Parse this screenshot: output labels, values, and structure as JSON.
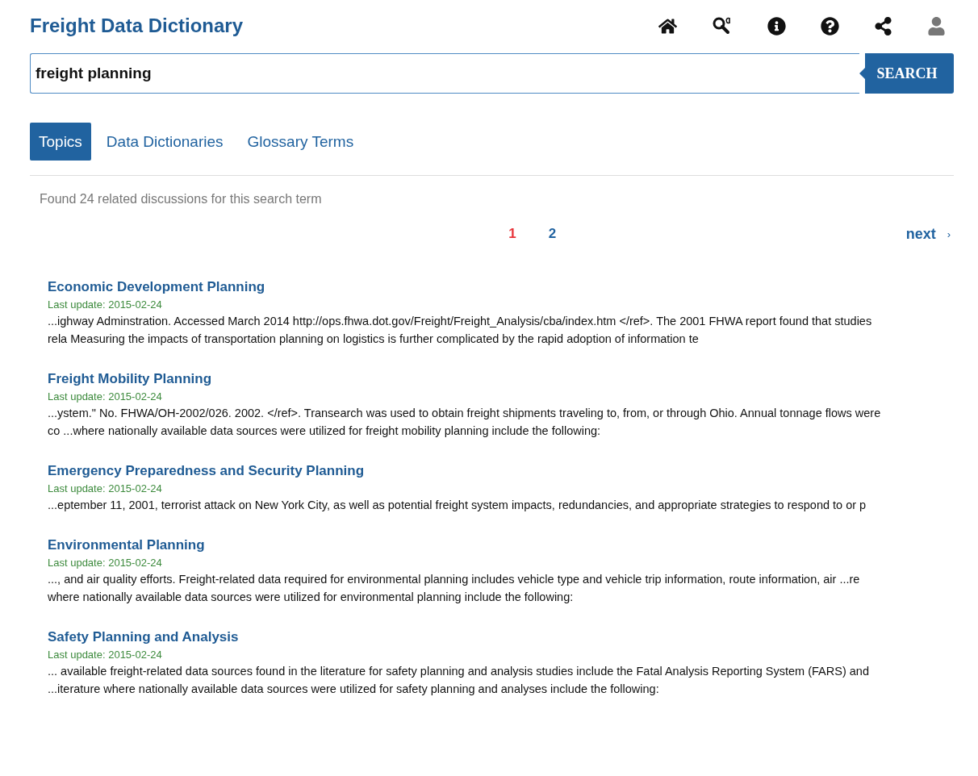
{
  "header": {
    "title": "Freight Data Dictionary",
    "icons": [
      {
        "kind": "home"
      },
      {
        "kind": "glossary"
      },
      {
        "kind": "info"
      },
      {
        "kind": "help"
      },
      {
        "kind": "share"
      },
      {
        "kind": "user"
      }
    ]
  },
  "search": {
    "value": "freight planning",
    "button": "SEARCH"
  },
  "tabs": [
    {
      "label": "Topics",
      "selected": true
    },
    {
      "label": "Data Dictionaries",
      "selected": false
    },
    {
      "label": "Glossary Terms",
      "selected": false
    }
  ],
  "summary": "Found 24 related discussions for this search term",
  "pagination": {
    "pages": [
      {
        "label": "1",
        "selected": true
      },
      {
        "label": "2",
        "selected": false
      }
    ],
    "next": "next",
    "next_arrow": "›"
  },
  "results": [
    {
      "title": "Economic Development Planning",
      "updated": "Last update: 2015-02-24",
      "excerpt": "...ighway Adminstration. Accessed March 2014 http://ops.fhwa.dot.gov/Freight/Freight_Analysis/cba/index.htm </ref>. The 2001 FHWA report found that studies rela Measuring the impacts of transportation planning on logistics is further complicated by the rapid adoption of information te"
    },
    {
      "title": "Freight Mobility Planning",
      "updated": "Last update: 2015-02-24",
      "excerpt": "...ystem.\" No. FHWA/OH-2002/026. 2002. </ref>. Transearch was used to obtain freight shipments traveling to, from, or through Ohio. Annual tonnage flows were co ...where nationally available data sources were utilized for freight mobility planning include the following:"
    },
    {
      "title": "Emergency Preparedness and Security Planning",
      "updated": "Last update: 2015-02-24",
      "excerpt": "...eptember 11, 2001, terrorist attack on New York City, as well as potential freight system impacts, redundancies, and appropriate strategies to respond to or p"
    },
    {
      "title": "Environmental Planning",
      "updated": "Last update: 2015-02-24",
      "excerpt": "..., and air quality efforts. Freight-related data required for environmental planning includes vehicle type and vehicle trip information, route information, air ...re where nationally available data sources were utilized for environmental planning include the following:"
    },
    {
      "title": "Safety Planning and Analysis",
      "updated": "Last update: 2015-02-24",
      "excerpt": "... available freight-related data sources found in the literature for safety planning and analysis studies include the Fatal Analysis Reporting System (FARS) and ...iterature where nationally available data sources were utilized for safety planning and analyses include the following:"
    }
  ]
}
